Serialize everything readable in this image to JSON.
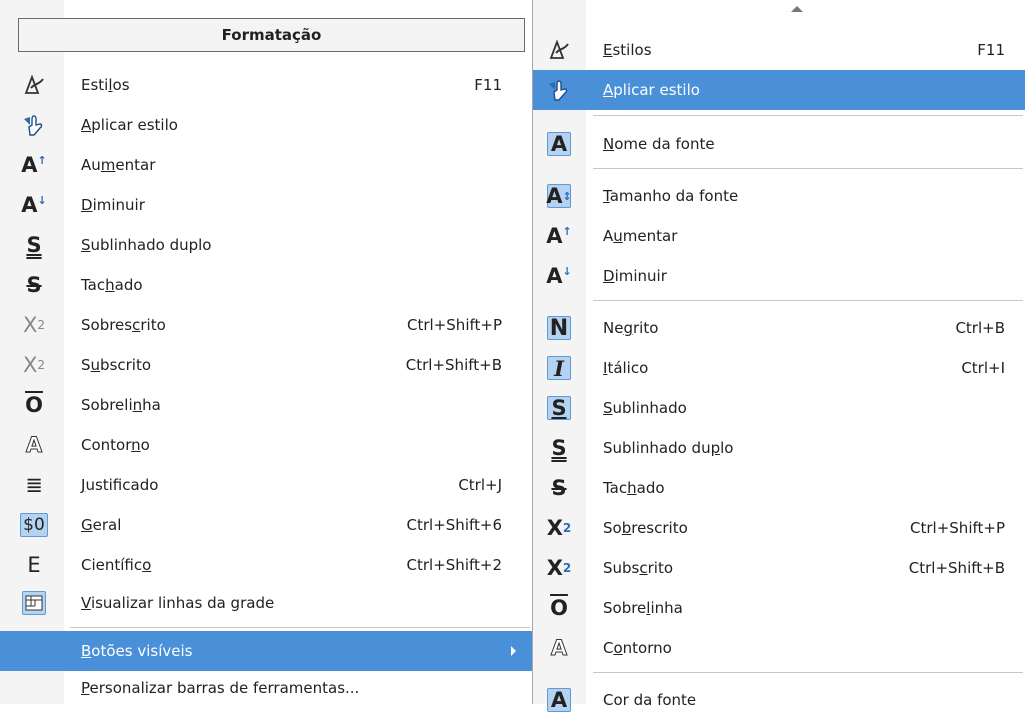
{
  "left_menu": {
    "title": "Formatação",
    "items": [
      {
        "pre": "Esti",
        "u": "l",
        "post": "os",
        "shortcut": "F11",
        "icon": "styles-icon"
      },
      {
        "pre": "",
        "u": "A",
        "post": "plicar estilo",
        "shortcut": "",
        "icon": "apply-style-icon"
      },
      {
        "pre": "Au",
        "u": "m",
        "post": "entar",
        "shortcut": "",
        "icon": "grow-font-icon"
      },
      {
        "pre": "",
        "u": "D",
        "post": "iminuir",
        "shortcut": "",
        "icon": "shrink-font-icon"
      },
      {
        "pre": "",
        "u": "S",
        "post": "ublinhado duplo",
        "shortcut": "",
        "icon": "double-underline-icon"
      },
      {
        "pre": "Tac",
        "u": "h",
        "post": "ado",
        "shortcut": "",
        "icon": "strikethrough-icon"
      },
      {
        "pre": "Sobres",
        "u": "c",
        "post": "rito",
        "shortcut": "Ctrl+Shift+P",
        "icon": "superscript-icon"
      },
      {
        "pre": "S",
        "u": "u",
        "post": "bscrito",
        "shortcut": "Ctrl+Shift+B",
        "icon": "subscript-icon"
      },
      {
        "pre": "Sobreli",
        "u": "n",
        "post": "ha",
        "shortcut": "",
        "icon": "overline-icon"
      },
      {
        "pre": "Contor",
        "u": "n",
        "post": "o",
        "shortcut": "",
        "icon": "outline-icon"
      },
      {
        "pre": "",
        "u": "J",
        "post": "ustificado",
        "shortcut": "Ctrl+J",
        "icon": "justify-icon"
      },
      {
        "pre": "",
        "u": "G",
        "post": "eral",
        "shortcut": "Ctrl+Shift+6",
        "icon": "number-format-general-icon"
      },
      {
        "pre": "Científic",
        "u": "o",
        "post": "",
        "shortcut": "Ctrl+Shift+2",
        "icon": "scientific-format-icon"
      },
      {
        "pre": "",
        "u": "V",
        "post": "isualizar linhas da grade",
        "shortcut": "",
        "icon": "grid-lines-icon"
      },
      {
        "pre": "",
        "u": "B",
        "post": "otões visíveis",
        "shortcut": "",
        "icon": ""
      },
      {
        "pre": "",
        "u": "P",
        "post": "ersonalizar barras de ferramentas...",
        "shortcut": "",
        "icon": ""
      }
    ],
    "icon_glyphs": {
      "grow": "A",
      "shrink": "A",
      "dbl": "S",
      "strike": "S",
      "sup": "X",
      "sup_n": "2",
      "sub": "X",
      "sub_n": "2",
      "over": "O",
      "outline": "A",
      "justify": "≣",
      "general": "$0",
      "sci": "E"
    }
  },
  "right_menu": {
    "items": [
      {
        "pre": "",
        "u": "E",
        "post": "stilos",
        "shortcut": "F11",
        "icon": "styles-icon"
      },
      {
        "pre": "",
        "u": "A",
        "post": "plicar estilo",
        "shortcut": "",
        "icon": "apply-style-icon"
      },
      {
        "pre": "",
        "u": "N",
        "post": "ome da fonte",
        "shortcut": "",
        "icon": "font-name-icon"
      },
      {
        "pre": "",
        "u": "T",
        "post": "amanho da fonte",
        "shortcut": "",
        "icon": "font-size-icon"
      },
      {
        "pre": "A",
        "u": "u",
        "post": "mentar",
        "shortcut": "",
        "icon": "grow-font-icon"
      },
      {
        "pre": "",
        "u": "D",
        "post": "iminuir",
        "shortcut": "",
        "icon": "shrink-font-icon"
      },
      {
        "pre": "Ne",
        "u": "g",
        "post": "rito",
        "shortcut": "Ctrl+B",
        "icon": "bold-icon"
      },
      {
        "pre": "",
        "u": "I",
        "post": "tálico",
        "shortcut": "Ctrl+I",
        "icon": "italic-icon"
      },
      {
        "pre": "",
        "u": "S",
        "post": "ublinhado",
        "shortcut": "",
        "icon": "underline-icon"
      },
      {
        "pre": "Sublinhado du",
        "u": "p",
        "post": "lo",
        "shortcut": "",
        "icon": "double-underline-icon"
      },
      {
        "pre": "Tac",
        "u": "h",
        "post": "ado",
        "shortcut": "",
        "icon": "strikethrough-icon"
      },
      {
        "pre": "So",
        "u": "b",
        "post": "rescrito",
        "shortcut": "Ctrl+Shift+P",
        "icon": "superscript-icon"
      },
      {
        "pre": "Subs",
        "u": "c",
        "post": "rito",
        "shortcut": "Ctrl+Shift+B",
        "icon": "subscript-icon"
      },
      {
        "pre": "Sobre",
        "u": "l",
        "post": "inha",
        "shortcut": "",
        "icon": "overline-icon"
      },
      {
        "pre": "C",
        "u": "o",
        "post": "ntorno",
        "shortcut": "",
        "icon": "outline-icon"
      },
      {
        "pre": "Cor da fonte",
        "u": "",
        "post": "",
        "shortcut": "",
        "icon": "font-color-icon"
      }
    ],
    "icon_glyphs": {
      "font_name": "A",
      "font_size": "A",
      "grow": "A",
      "shrink": "A",
      "bold": "N",
      "italic": "I",
      "underline": "S",
      "dbl": "S",
      "strike": "S",
      "sup": "X",
      "sup_n": "2",
      "sub": "X",
      "sub_n": "2",
      "over": "O",
      "outline": "A",
      "color": "A"
    }
  },
  "colors": {
    "highlight": "#4a90d9",
    "checked_bg": "#b5d3f0",
    "checked_border": "#5f9ad3",
    "separator": "#c6c6c6",
    "disabled": "#888888"
  }
}
